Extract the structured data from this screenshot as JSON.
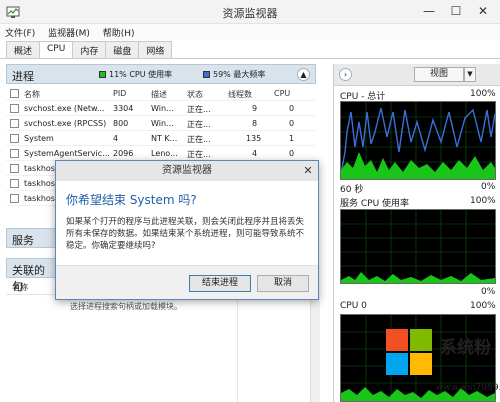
{
  "window": {
    "title": "资源监视器",
    "controls": {
      "minimize": "—",
      "maximize": "☐",
      "close": "✕"
    }
  },
  "menu": [
    "文件(F)",
    "监视器(M)",
    "帮助(H)"
  ],
  "tabs": [
    {
      "label": "概述",
      "active": false
    },
    {
      "label": "CPU",
      "active": true
    },
    {
      "label": "内存",
      "active": false
    },
    {
      "label": "磁盘",
      "active": false
    },
    {
      "label": "网络",
      "active": false
    }
  ],
  "processes": {
    "title": "进程",
    "cpu_usage_label": "11% CPU 使用率",
    "max_freq_label": "59% 最大频率",
    "columns": [
      "名称",
      "PID",
      "描述",
      "状态",
      "线程数",
      "CPU"
    ],
    "rows": [
      {
        "name": "svchost.exe (Netw...",
        "pid": "3304",
        "desc": "Win...",
        "status": "正在...",
        "threads": "9",
        "cpu": "0"
      },
      {
        "name": "svchost.exe (RPCSS)",
        "pid": "800",
        "desc": "Win...",
        "status": "正在...",
        "threads": "8",
        "cpu": "0"
      },
      {
        "name": "System",
        "pid": "4",
        "desc": "NT K...",
        "status": "正在...",
        "threads": "135",
        "cpu": "1"
      },
      {
        "name": "SystemAgentServic...",
        "pid": "2096",
        "desc": "Leno...",
        "status": "正在...",
        "threads": "4",
        "cpu": "0"
      },
      {
        "name": "taskhos",
        "pid": "",
        "desc": "",
        "status": "",
        "threads": "",
        "cpu": ""
      },
      {
        "name": "taskhos",
        "pid": "",
        "desc": "",
        "status": "",
        "threads": "",
        "cpu": ""
      },
      {
        "name": "taskhos",
        "pid": "",
        "desc": "",
        "status": "",
        "threads": "",
        "cpu": ""
      }
    ]
  },
  "services": {
    "title": "服务"
  },
  "associated": {
    "title": "关联的句",
    "column": "名称",
    "partial_text": "选择进程搜索句柄或加载模块。"
  },
  "right_panel": {
    "view_label": "视图",
    "graphs": [
      {
        "title": "CPU - 总计",
        "top": "100%",
        "bottom_left": "60 秒",
        "bottom_right": "0%"
      },
      {
        "title": "服务 CPU 使用率",
        "top": "100%",
        "bottom_left": "",
        "bottom_right": "0%"
      },
      {
        "title": "CPU 0",
        "top": "100%",
        "bottom_left": "",
        "bottom_right": ""
      }
    ]
  },
  "dialog": {
    "title": "资源监视器",
    "heading": "你希望结束 System 吗?",
    "body": "如果某个打开的程序与此进程关联，则会关闭此程序并且将丢失所有未保存的数据。如果结束某个系统进程，则可能导致系统不稳定。你确定要继续吗?",
    "confirm": "结束进程",
    "cancel": "取消"
  },
  "watermark": {
    "text": "系统粉",
    "url": "www.win7999.com"
  },
  "colors": {
    "graph_bg": "#000000",
    "graph_green": "#19c519",
    "graph_blue": "#3a6fd8",
    "accent_heading": "#1c5eac",
    "section_header": "#d9e3ec"
  }
}
